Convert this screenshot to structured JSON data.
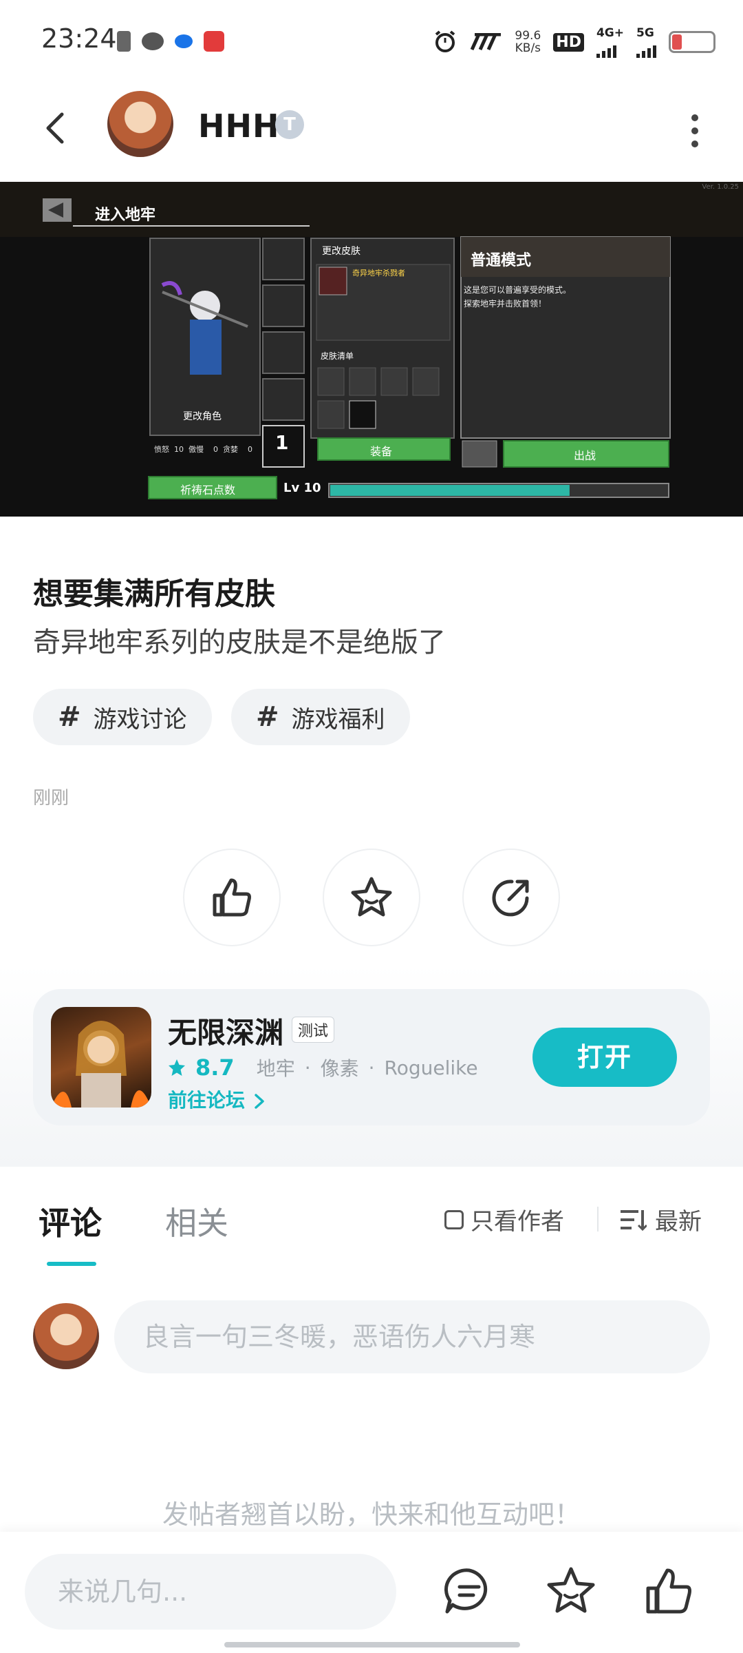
{
  "status_bar": {
    "time": "23:24",
    "net_speed": "99.6",
    "net_unit": "KB/s",
    "hd": "HD",
    "sim1": "4G+",
    "sim2": "5G",
    "battery": "9"
  },
  "header": {
    "user_name": "HHH",
    "badge": "T"
  },
  "game_screenshot": {
    "version": "Ver. 1.0.25",
    "enter_dungeon": "进入地牢",
    "change_skin": "更改皮肤",
    "skin_name": "奇异地牢杀戮者",
    "skin_list": "皮肤清单",
    "mode": "普通模式",
    "mode_desc_1": "这是您可以普遍享受的模式。",
    "mode_desc_2": "探索地牢并击败首领！",
    "change_char": "更改角色",
    "stat_line": "愤怒  10  傲慢    0  贪婪    0",
    "count": "1",
    "equip": "装备",
    "fight": "出战",
    "prayer": "祈祷石点数",
    "level": "Lv 10",
    "level_progress": 0.71
  },
  "post": {
    "title": "想要集满所有皮肤",
    "subtitle": "奇异地牢系列的皮肤是不是绝版了",
    "tags": [
      "游戏讨论",
      "游戏福利"
    ],
    "time": "刚刚"
  },
  "game_card": {
    "name": "无限深渊",
    "badge": "测试",
    "rating": "8.7",
    "genre1": "地牢",
    "genre2": "像素",
    "genre3": "Roguelike",
    "dot": "·",
    "forum_link": "前往论坛",
    "open_label": "打开"
  },
  "comments": {
    "tab_comments": "评论",
    "tab_related": "相关",
    "author_only": "只看作者",
    "sort": "最新",
    "input_placeholder": "良言一句三冬暖，恶语伤人六月寒",
    "empty_hint": "发帖者翘首以盼，快来和他互动吧！"
  },
  "bottom_bar": {
    "input_placeholder": "来说几句..."
  },
  "colors": {
    "accent": "#17bcc6",
    "background": "#ffffff"
  }
}
